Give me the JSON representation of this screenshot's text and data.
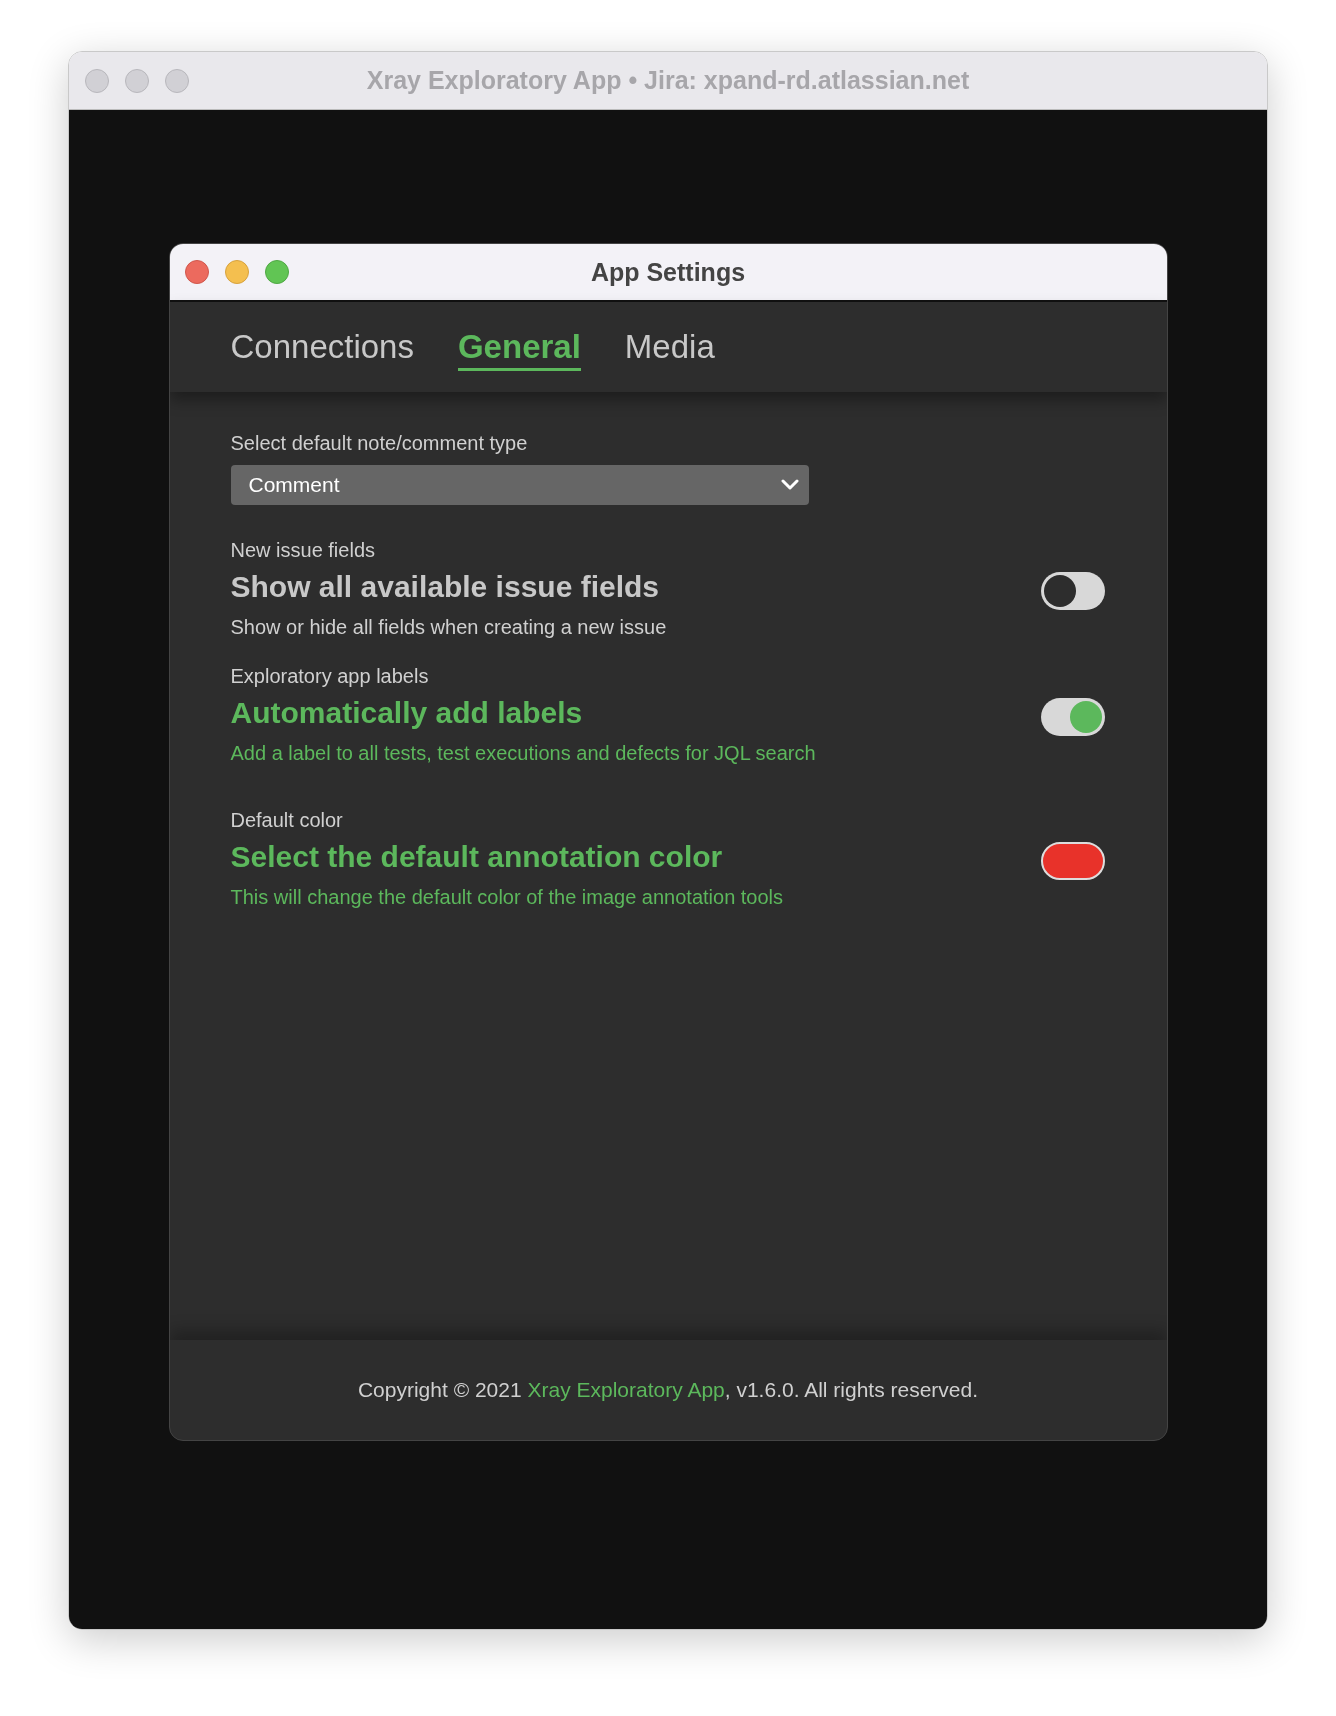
{
  "window": {
    "title": "Xray Exploratory App • Jira: xpand-rd.atlassian.net"
  },
  "dialog": {
    "title": "App Settings"
  },
  "tabs": [
    {
      "label": "Connections",
      "selected": false
    },
    {
      "label": "General",
      "selected": true
    },
    {
      "label": "Media",
      "selected": false
    }
  ],
  "note_type": {
    "label": "Select default note/comment type",
    "value": "Comment"
  },
  "settings": [
    {
      "kind": "toggle",
      "section": "New issue fields",
      "title": "Show all available issue fields",
      "description": "Show or hide all fields when creating a new issue",
      "on": false
    },
    {
      "kind": "toggle",
      "section": "Exploratory app labels",
      "title": "Automatically add labels",
      "description": "Add a label to all tests, test executions and defects for JQL search",
      "on": true
    },
    {
      "kind": "color",
      "section": "Default color",
      "title": "Select the default annotation color",
      "description": "This will change the default color of the image annotation tools",
      "color": "#e8322a"
    }
  ],
  "footer": {
    "before": "Copyright © 2021 ",
    "link": "Xray Exploratory App",
    "after": ", v1.6.0. All rights reserved."
  }
}
